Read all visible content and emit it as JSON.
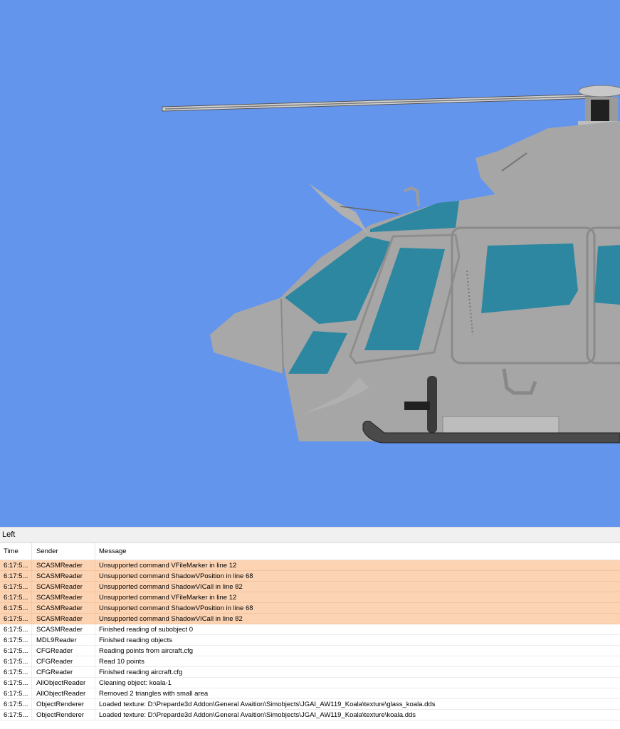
{
  "colors": {
    "sky": "#6495ed",
    "fuselage": "#a6a6a6",
    "glass": "#2e87a0",
    "warning_row": "#fcd4b4"
  },
  "viewport": {
    "subject": "helicopter-3d-model"
  },
  "panel": {
    "title": "Left"
  },
  "log": {
    "columns": {
      "time": "Time",
      "sender": "Sender",
      "message": "Message"
    },
    "rows": [
      {
        "time": "6:17:5...",
        "sender": "SCASMReader",
        "message": "Unsupported command VFileMarker in line 12",
        "level": "warn"
      },
      {
        "time": "6:17:5...",
        "sender": "SCASMReader",
        "message": "Unsupported command ShadowVPosition in line 68",
        "level": "warn"
      },
      {
        "time": "6:17:5...",
        "sender": "SCASMReader",
        "message": "Unsupported command ShadowVICall in line 82",
        "level": "warn"
      },
      {
        "time": "6:17:5...",
        "sender": "SCASMReader",
        "message": "Unsupported command VFileMarker in line 12",
        "level": "warn"
      },
      {
        "time": "6:17:5...",
        "sender": "SCASMReader",
        "message": "Unsupported command ShadowVPosition in line 68",
        "level": "warn"
      },
      {
        "time": "6:17:5...",
        "sender": "SCASMReader",
        "message": "Unsupported command ShadowVICall in line 82",
        "level": "warn"
      },
      {
        "time": "6:17:5...",
        "sender": "SCASMReader",
        "message": "Finished reading of subobject 0",
        "level": "info"
      },
      {
        "time": "6:17:5...",
        "sender": "MDL9Reader",
        "message": "Finished reading objects",
        "level": "info"
      },
      {
        "time": "6:17:5...",
        "sender": "CFGReader",
        "message": "Reading points from aircraft.cfg",
        "level": "info"
      },
      {
        "time": "6:17:5...",
        "sender": "CFGReader",
        "message": "Read 10 points",
        "level": "info"
      },
      {
        "time": "6:17:5...",
        "sender": "CFGReader",
        "message": "Finished reading aircraft.cfg",
        "level": "info"
      },
      {
        "time": "6:17:5...",
        "sender": "AllObjectReader",
        "message": "Cleaning object: koala-1",
        "level": "info"
      },
      {
        "time": "6:17:5...",
        "sender": "AllObjectReader",
        "message": "Removed 2 triangles with small area",
        "level": "info"
      },
      {
        "time": "6:17:5...",
        "sender": "ObjectRenderer",
        "message": "Loaded texture: D:\\Preparde3d Addon\\General Avaition\\Simobjects\\JGAI_AW119_Koala\\texture\\glass_koala.dds",
        "level": "info"
      },
      {
        "time": "6:17:5...",
        "sender": "ObjectRenderer",
        "message": "Loaded texture: D:\\Preparde3d Addon\\General Avaition\\Simobjects\\JGAI_AW119_Koala\\texture\\koala.dds",
        "level": "info"
      }
    ]
  }
}
